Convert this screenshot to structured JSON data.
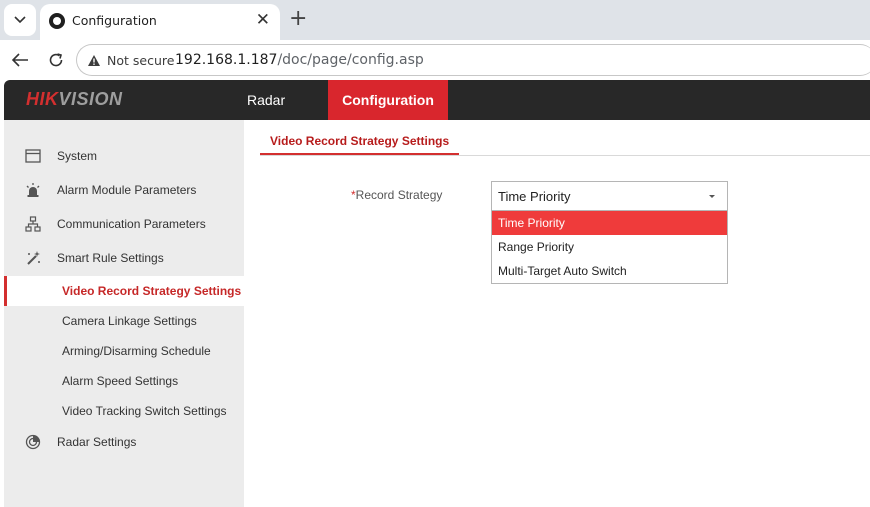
{
  "browser": {
    "tab_title": "Configuration",
    "tab_close": "✕",
    "new_tab": "+",
    "security_label": "Not secure",
    "url_host": "192.168.1.187",
    "url_path": "/doc/page/config.asp"
  },
  "header": {
    "logo_part1": "HIK",
    "logo_part2": "VISION",
    "nav": [
      "Radar",
      "Configuration"
    ],
    "active_nav": "Configuration",
    "accent_color": "#d9262d"
  },
  "sidebar": {
    "items": [
      {
        "label": "System",
        "icon": "window-icon"
      },
      {
        "label": "Alarm Module Parameters",
        "icon": "alarm-light-icon"
      },
      {
        "label": "Communication Parameters",
        "icon": "network-icon"
      },
      {
        "label": "Smart Rule Settings",
        "icon": "magic-wand-icon"
      }
    ],
    "sub_items": [
      "Video Record Strategy Settings",
      "Camera Linkage Settings",
      "Arming/Disarming Schedule",
      "Alarm Speed Settings",
      "Video Tracking Switch Settings"
    ],
    "active_sub_item": "Video Record Strategy Settings",
    "bottom_item": {
      "label": "Radar Settings",
      "icon": "radar-icon"
    }
  },
  "content": {
    "section_title": "Video Record Strategy Settings",
    "field": {
      "required_mark": "*",
      "label": "Record Strategy",
      "value": "Time Priority",
      "options": [
        "Time Priority",
        "Range Priority",
        "Multi-Target Auto Switch"
      ],
      "highlighted_option": "Time Priority"
    }
  }
}
